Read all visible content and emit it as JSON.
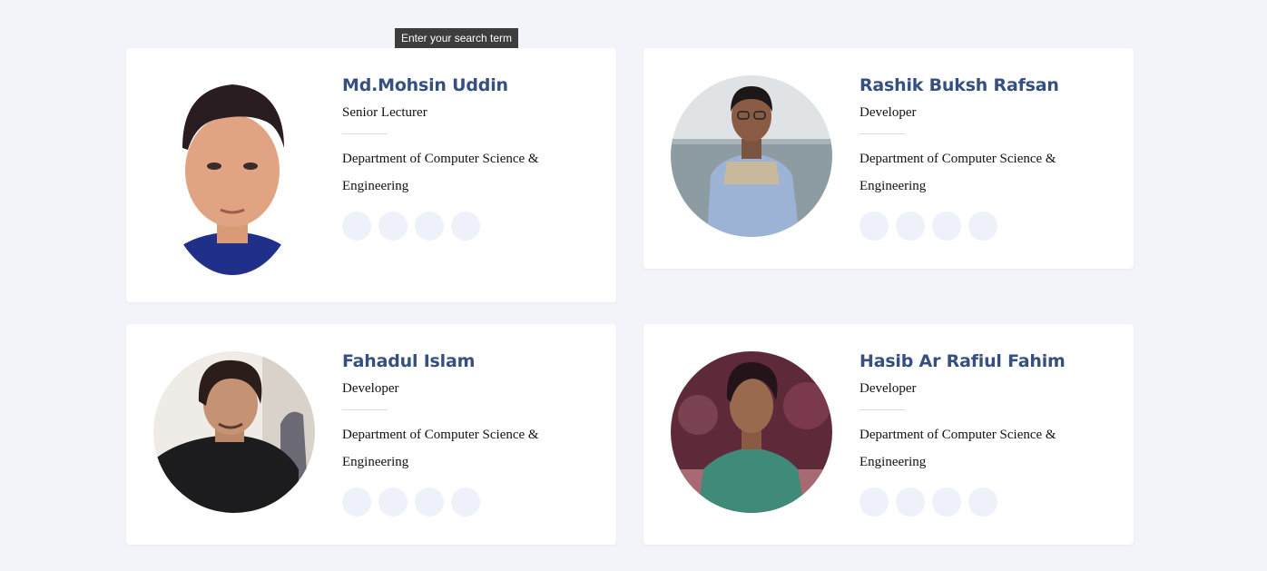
{
  "tooltip": {
    "text": "Enter your search term"
  },
  "members": [
    {
      "name": "Md.Mohsin Uddin",
      "role": "Senior Lecturer",
      "department": "Department of Computer Science & Engineering",
      "socials": [
        "social-link-1-icon",
        "social-link-2-icon",
        "social-link-3-icon",
        "social-link-4-icon"
      ]
    },
    {
      "name": "Rashik Buksh Rafsan",
      "role": "Developer",
      "department": "Department of Computer Science & Engineering",
      "socials": [
        "social-link-1-icon",
        "social-link-2-icon",
        "social-link-3-icon",
        "social-link-4-icon"
      ]
    },
    {
      "name": "Fahadul Islam",
      "role": "Developer",
      "department": "Department of Computer Science & Engineering",
      "socials": [
        "social-link-1-icon",
        "social-link-2-icon",
        "social-link-3-icon",
        "social-link-4-icon"
      ]
    },
    {
      "name": "Hasib Ar Rafiul Fahim",
      "role": "Developer",
      "department": "Department of Computer Science & Engineering",
      "socials": [
        "social-link-1-icon",
        "social-link-2-icon",
        "social-link-3-icon",
        "social-link-4-icon"
      ]
    }
  ],
  "colors": {
    "page_bg": "#f3f4f9",
    "name": "#354f80",
    "social_bg": "#eef1f9"
  }
}
